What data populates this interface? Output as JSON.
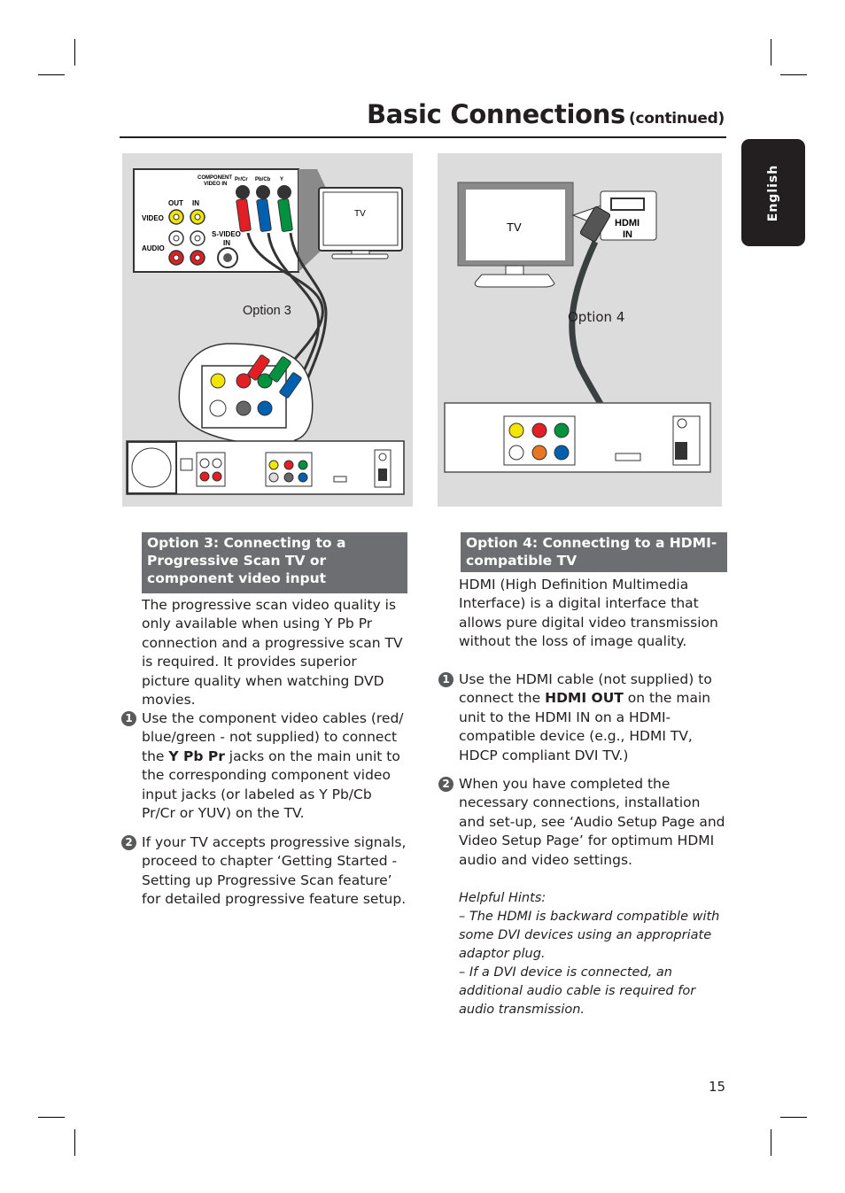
{
  "header": {
    "title": "Basic Connections",
    "title_suffix": "(continued)"
  },
  "language_tab": "English",
  "figure_left": {
    "option_label": "Option 3",
    "tv_label": "TV",
    "panel_labels": {
      "component_video_in_1": "COMPONENT",
      "component_video_in_2": "VIDEO IN",
      "pr_cr": "Pr/Cr",
      "pb_cb": "Pb/Cb",
      "y": "Y",
      "out": "OUT",
      "in": "IN",
      "video": "VIDEO",
      "audio": "AUDIO",
      "svideo_1": "S-VIDEO",
      "svideo_2": "IN"
    }
  },
  "figure_right": {
    "option_label": "Option 4",
    "tv_label": "TV",
    "hdmi_in_1": "HDMI",
    "hdmi_in_2": "IN"
  },
  "left_column": {
    "section_heading": "Option 3: Connecting to a Progressive Scan TV or component video input",
    "intro": "The progressive scan video quality is only available when using Y Pb Pr connection and a progressive scan TV is required. It provides superior picture quality when watching DVD movies.",
    "steps": [
      {
        "number": "1",
        "before": "Use the component video cables (red/ blue/green - not supplied) to connect the ",
        "bold": "Y Pb Pr",
        "after": " jacks on the main unit to the corresponding component video input jacks (or labeled as Y Pb/Cb Pr/Cr or YUV) on the TV."
      },
      {
        "number": "2",
        "text": "If your TV accepts progressive signals, proceed to chapter ‘Getting Started - Setting up Progressive Scan feature’ for detailed progressive feature setup."
      }
    ]
  },
  "right_column": {
    "section_heading": "Option 4: Connecting to a HDMI-compatible TV",
    "intro": "HDMI (High Definition Multimedia Interface) is a digital interface that allows pure digital video transmission without the loss of image quality.",
    "steps": [
      {
        "number": "1",
        "before": "Use the HDMI cable (not supplied) to connect the ",
        "bold": "HDMI OUT",
        "after": " on the main unit to the HDMI IN on a HDMI-compatible device (e.g., HDMI TV, HDCP compliant DVI TV.)"
      },
      {
        "number": "2",
        "text": "When you have completed the necessary connections, installation and set-up, see ‘Audio Setup Page and Video Setup Page’ for optimum HDMI audio and video settings."
      }
    ],
    "hints_title": "Helpful Hints:",
    "hints": [
      "–  The HDMI is backward compatible with some DVI devices using an appropriate adaptor plug.",
      "–  If a DVI device is connected, an additional audio cable is required for audio transmission."
    ]
  },
  "page_number": "15",
  "colors": {
    "section_heading_bg": "#6d6e71",
    "figure_bg": "#dcdcdc",
    "jack_red": "#e31e24",
    "jack_green": "#00923f",
    "jack_blue": "#0060b0",
    "jack_yellow": "#f2e600",
    "jack_orange": "#e87722"
  }
}
